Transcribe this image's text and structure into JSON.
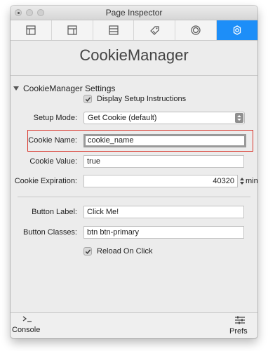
{
  "window": {
    "title": "Page Inspector"
  },
  "tabs": [
    {
      "icon": "layout-icon",
      "active": false
    },
    {
      "icon": "sidebar-layout-icon",
      "active": false
    },
    {
      "icon": "columns-icon",
      "active": false
    },
    {
      "icon": "tag-icon",
      "active": false
    },
    {
      "icon": "circle-target-icon",
      "active": false
    },
    {
      "icon": "gear-icon",
      "active": true
    }
  ],
  "colors": {
    "accent": "#1d8ef8",
    "highlight_border": "#d9352b"
  },
  "app_title": "CookieManager",
  "section": {
    "title": "CookieManager Settings"
  },
  "settings": {
    "display_setup_instructions": {
      "label": "Display Setup Instructions",
      "checked": true
    },
    "setup_mode": {
      "label": "Setup Mode:",
      "value": "Get Cookie (default)"
    },
    "cookie_name": {
      "label": "Cookie Name:",
      "value": "cookie_name"
    },
    "cookie_value": {
      "label": "Cookie Value:",
      "value": "true"
    },
    "cookie_expiration": {
      "label": "Cookie Expiration:",
      "value": "40320",
      "unit": "min"
    },
    "button_label": {
      "label": "Button Label:",
      "value": "Click Me!"
    },
    "button_classes": {
      "label": "Button Classes:",
      "value": "btn btn-primary"
    },
    "reload_on_click": {
      "label": "Reload On Click",
      "checked": true
    }
  },
  "bottombar": {
    "console": {
      "label": "Console",
      "icon": "terminal-icon"
    },
    "prefs": {
      "label": "Prefs",
      "icon": "sliders-icon"
    }
  }
}
